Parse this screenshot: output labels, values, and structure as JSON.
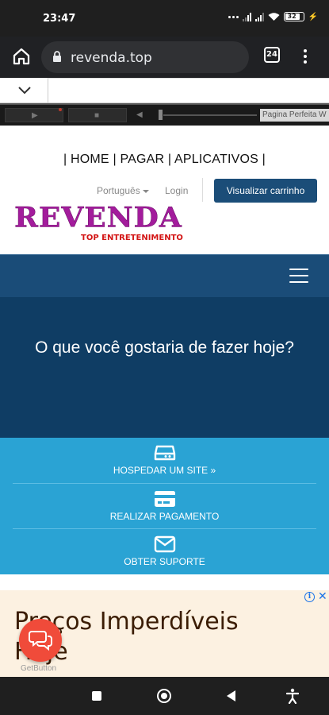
{
  "status_bar": {
    "time": "23:47",
    "battery": "32"
  },
  "browser": {
    "url": "revenda.top",
    "tab_count": "24"
  },
  "player": {
    "page_label": "Pagina Perfeita W"
  },
  "site": {
    "topnav": "| HOME | PAGAR | APLICATIVOS |",
    "language": "Português",
    "login": "Login",
    "cart_button": "Visualizar carrinho",
    "logo_main": "REVENDA",
    "logo_sub": "TOP ENTRETENIMENTO"
  },
  "hero": {
    "title": "O que você gostaria de fazer hoje?"
  },
  "actions": [
    {
      "label": "HOSPEDAR UM SITE »",
      "icon": "server-icon"
    },
    {
      "label": "REALIZAR PAGAMENTO",
      "icon": "credit-card-icon"
    },
    {
      "label": "OBTER SUPORTE",
      "icon": "envelope-icon"
    }
  ],
  "ad": {
    "text": "Preços Imperdíveis Hoje"
  },
  "chat": {
    "brand": "GetButton"
  },
  "colors": {
    "nav_blue": "#1a4c78",
    "hero_blue": "#0f3d64",
    "action_blue": "#2aa3d4",
    "logo_purple": "#a31c9c",
    "chat_red": "#f04b3a"
  }
}
